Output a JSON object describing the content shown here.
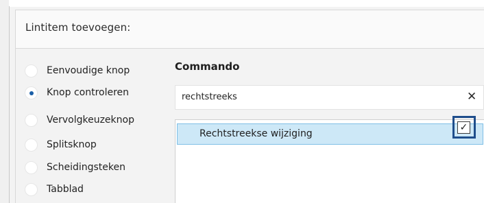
{
  "group": {
    "title": "Lintitem toevoegen:"
  },
  "radio_options": [
    {
      "label": "Eenvoudige knop",
      "checked": false
    },
    {
      "label": "Knop controleren",
      "checked": true
    },
    {
      "label": "Vervolgkeuzeknop",
      "checked": false
    },
    {
      "label": "Splitsknop",
      "checked": false
    },
    {
      "label": "Scheidingsteken",
      "checked": false
    },
    {
      "label": "Tabblad",
      "checked": false
    }
  ],
  "command": {
    "title": "Commando",
    "search_value": "rechtstreeks",
    "clear_icon": "close-icon",
    "results": [
      {
        "label": "Rechtstreekse wijziging",
        "checked": true,
        "selected": true
      }
    ]
  },
  "colors": {
    "accent": "#1b5fa7",
    "selection": "#cde8f7",
    "highlight_box": "#1f4e8c"
  }
}
